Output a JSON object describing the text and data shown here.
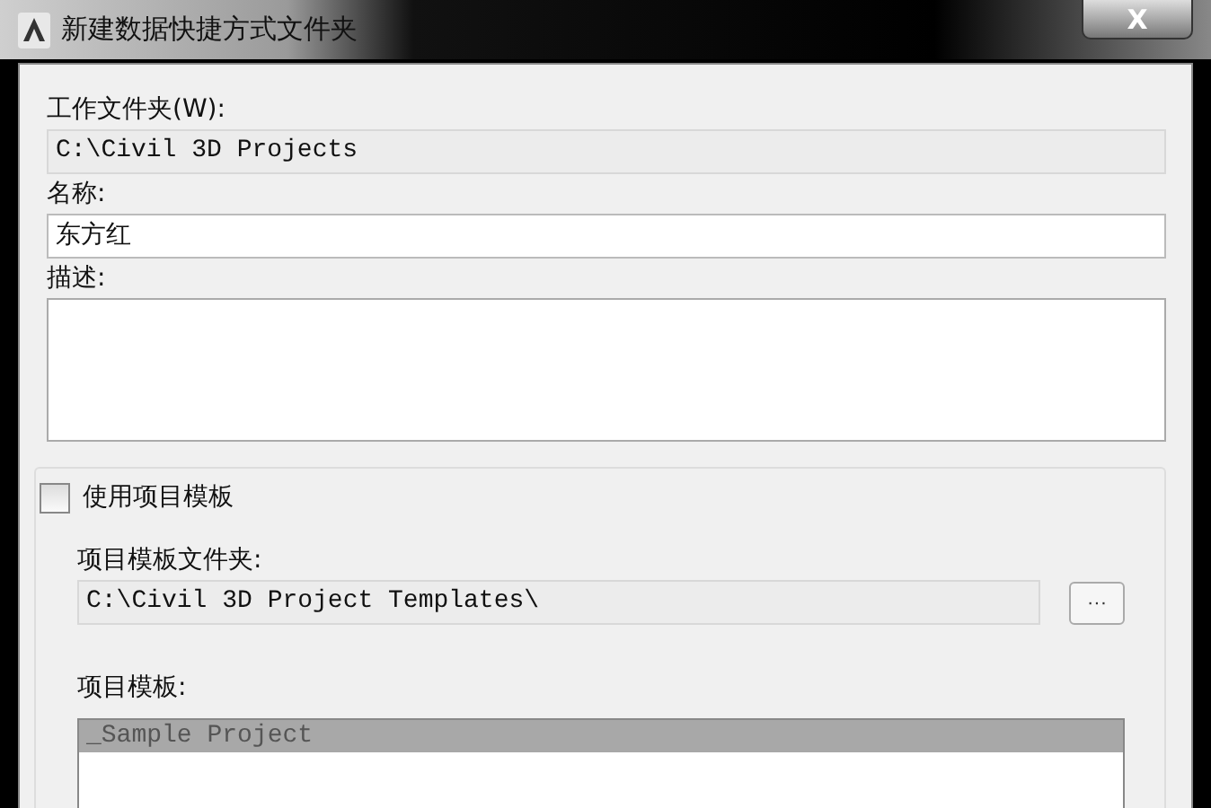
{
  "window": {
    "title": "新建数据快捷方式文件夹",
    "close": "X"
  },
  "working_folder": {
    "label": "工作文件夹(W):",
    "value": "C:\\Civil 3D Projects",
    "disabled": true
  },
  "name": {
    "label": "名称:",
    "value": "东方红"
  },
  "description": {
    "label": "描述:"
  },
  "use_template": {
    "label": "使用项目模板",
    "checked": false
  },
  "template_folder": {
    "label": "项目模板文件夹:",
    "value": "C:\\Civil 3D Project Templates\\",
    "disabled": true,
    "browse": "···"
  },
  "templates": {
    "label": "项目模板:",
    "disabled": true,
    "items": [
      {
        "label": "_Sample Project",
        "selected": true
      }
    ]
  }
}
